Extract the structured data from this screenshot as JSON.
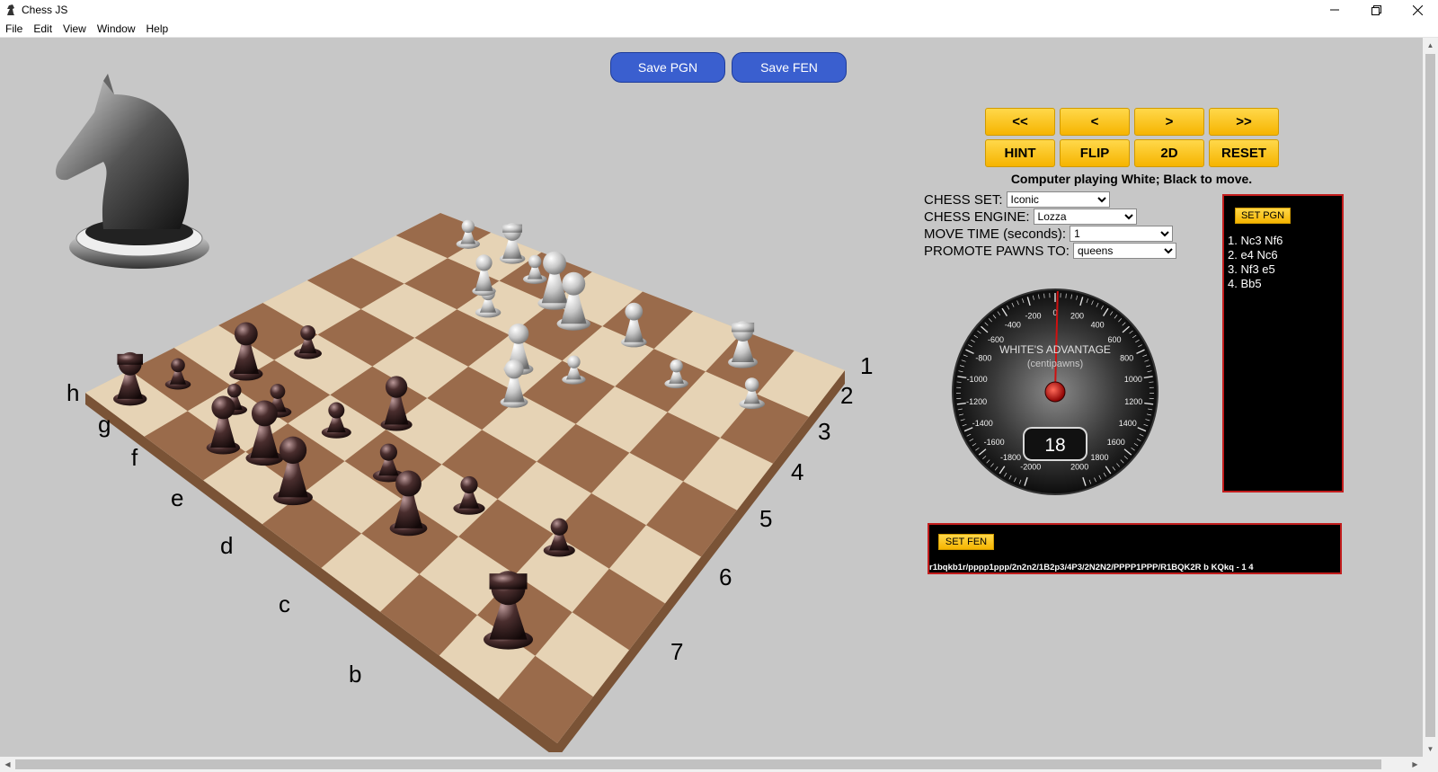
{
  "window": {
    "title": "Chess JS"
  },
  "menu": [
    "File",
    "Edit",
    "View",
    "Window",
    "Help"
  ],
  "toolbar": {
    "save_pgn": "Save PGN",
    "save_fen": "Save FEN"
  },
  "nav_buttons": [
    "<<",
    "<",
    ">",
    ">>"
  ],
  "action_buttons": [
    "HINT",
    "FLIP",
    "2D",
    "RESET"
  ],
  "status": "Computer playing White; Black to move.",
  "options": {
    "chess_set": {
      "label": "CHESS SET:",
      "value": "Iconic"
    },
    "chess_engine": {
      "label": "CHESS ENGINE:",
      "value": "Lozza"
    },
    "move_time": {
      "label": "MOVE TIME (seconds):",
      "value": "1"
    },
    "promote": {
      "label": "PROMOTE PAWNS TO:",
      "value": "queens"
    }
  },
  "gauge": {
    "title": "WHITE'S ADVANTAGE",
    "subtitle": "(centipawns)",
    "value": "18",
    "ticks": [
      "-2000",
      "-1800",
      "-1600",
      "-1400",
      "-1200",
      "-1000",
      "-800",
      "-600",
      "-400",
      "-200",
      "0",
      "200",
      "400",
      "600",
      "800",
      "1000",
      "1200",
      "1400",
      "1600",
      "1800",
      "2000"
    ]
  },
  "pgn": {
    "button": "SET PGN",
    "moves": [
      "1. Nc3 Nf6",
      "2. e4 Nc6",
      "3. Nf3 e5",
      "4. Bb5"
    ]
  },
  "fen": {
    "button": "SET FEN",
    "text": "r1bqkb1r/pppp1ppp/2n2n2/1B2p3/4P3/2N2N2/PPPP1PPP/R1BQK2R b KQkq - 1 4"
  },
  "board": {
    "rank_labels": [
      "1",
      "2",
      "3",
      "4",
      "5",
      "6",
      "7"
    ],
    "file_labels": [
      "h",
      "g",
      "f",
      "e",
      "d",
      "c",
      "b"
    ]
  },
  "colors": {
    "save_button": "#3a5fcf",
    "control_button": "#f6b400",
    "panel_border": "#c21d1d",
    "background": "#c7c7c7"
  }
}
